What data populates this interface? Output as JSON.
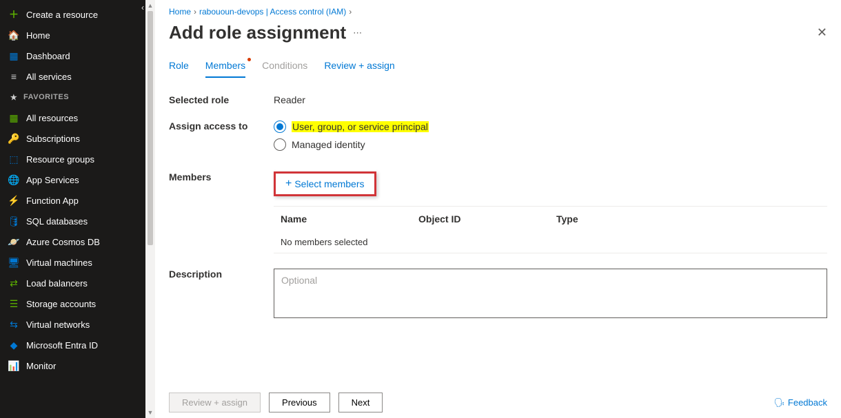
{
  "sidebar": {
    "createResource": "Create a resource",
    "home": "Home",
    "dashboard": "Dashboard",
    "allServices": "All services",
    "favoritesLabel": "FAVORITES",
    "allResources": "All resources",
    "subscriptions": "Subscriptions",
    "resourceGroups": "Resource groups",
    "appServices": "App Services",
    "functionApp": "Function App",
    "sqlDatabases": "SQL databases",
    "cosmosDb": "Azure Cosmos DB",
    "virtualMachines": "Virtual machines",
    "loadBalancers": "Load balancers",
    "storageAccounts": "Storage accounts",
    "virtualNetworks": "Virtual networks",
    "entraId": "Microsoft Entra ID",
    "monitor": "Monitor"
  },
  "breadcrumb": {
    "home": "Home",
    "resource": "rabououn-devops | Access control (IAM)"
  },
  "pageTitle": "Add role assignment",
  "tabs": {
    "role": "Role",
    "members": "Members",
    "conditions": "Conditions",
    "reviewAssign": "Review + assign"
  },
  "form": {
    "selectedRoleLabel": "Selected role",
    "selectedRoleValue": "Reader",
    "assignAccessLabel": "Assign access to",
    "radioUserGroup": "User, group, or service principal",
    "radioManagedIdentity": "Managed identity",
    "membersLabel": "Members",
    "selectMembers": "Select members",
    "tableHeaders": {
      "name": "Name",
      "objectId": "Object ID",
      "type": "Type"
    },
    "noMembers": "No members selected",
    "descriptionLabel": "Description",
    "descriptionPlaceholder": "Optional"
  },
  "footer": {
    "reviewAssign": "Review + assign",
    "previous": "Previous",
    "next": "Next",
    "feedback": "Feedback"
  }
}
